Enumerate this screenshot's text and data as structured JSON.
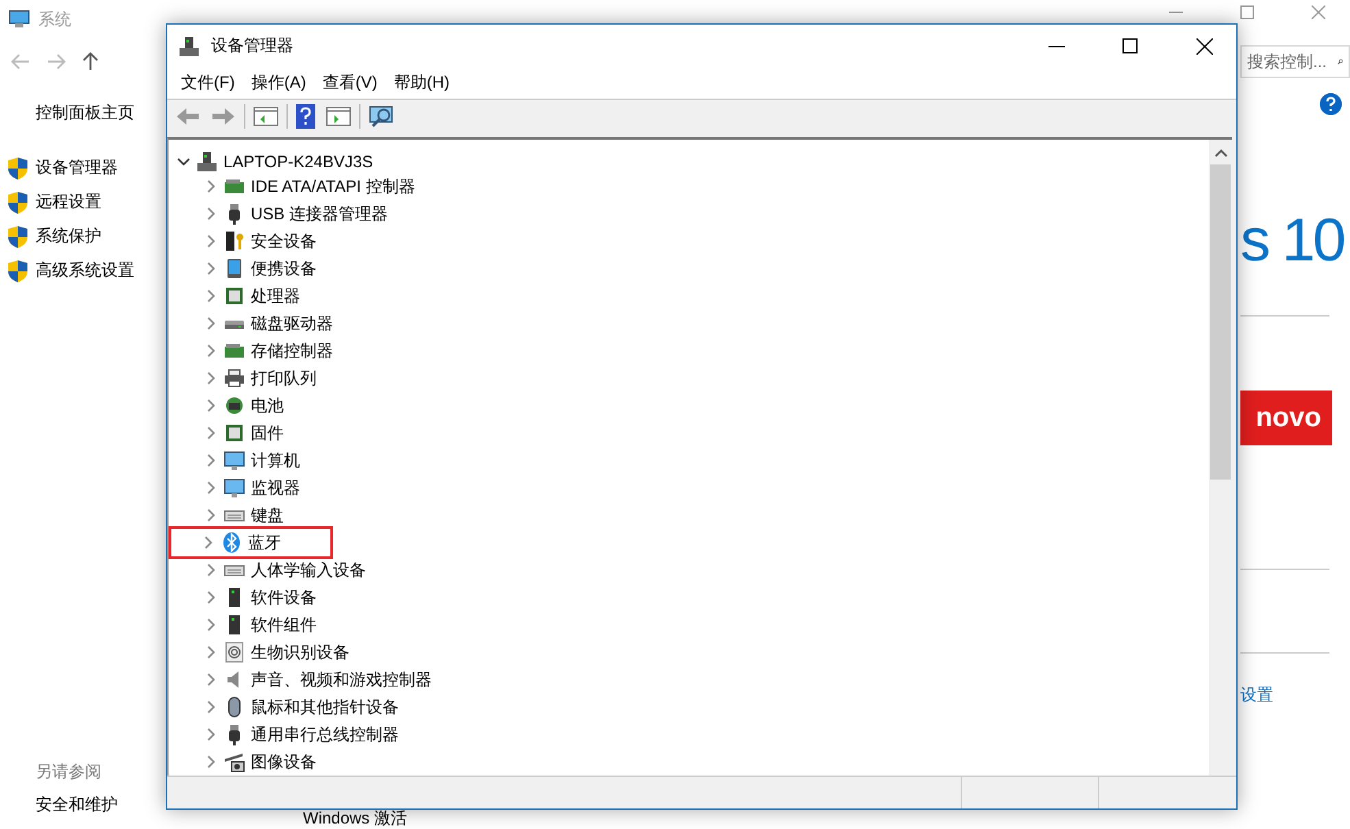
{
  "system_window": {
    "title": "系统",
    "search": {
      "placeholder": "搜索控制..."
    },
    "sidebar": {
      "home": "控制面板主页",
      "links": [
        "设备管理器",
        "远程设置",
        "系统保护",
        "高级系统设置"
      ],
      "see_also_title": "另请参阅",
      "see_also": [
        "安全和维护"
      ]
    },
    "content": {
      "edition_text": "s 10",
      "logo_text": "novo",
      "link": "设置",
      "activation_text": "Windows 激活"
    }
  },
  "device_manager": {
    "title": "设备管理器",
    "menu": [
      "文件(F)",
      "操作(A)",
      "查看(V)",
      "帮助(H)"
    ],
    "tree": {
      "label": "LAPTOP-K24BVJ3S",
      "expanded": true,
      "children": [
        {
          "label": "IDE ATA/ATAPI 控制器",
          "expanded": false,
          "highlighted": false
        },
        {
          "label": "USB 连接器管理器",
          "expanded": false,
          "highlighted": false
        },
        {
          "label": "安全设备",
          "expanded": false,
          "highlighted": false
        },
        {
          "label": "便携设备",
          "expanded": false,
          "highlighted": false
        },
        {
          "label": "处理器",
          "expanded": false,
          "highlighted": false
        },
        {
          "label": "磁盘驱动器",
          "expanded": false,
          "highlighted": false
        },
        {
          "label": "存储控制器",
          "expanded": false,
          "highlighted": false
        },
        {
          "label": "打印队列",
          "expanded": false,
          "highlighted": false
        },
        {
          "label": "电池",
          "expanded": false,
          "highlighted": false
        },
        {
          "label": "固件",
          "expanded": false,
          "highlighted": false
        },
        {
          "label": "计算机",
          "expanded": false,
          "highlighted": false
        },
        {
          "label": "监视器",
          "expanded": false,
          "highlighted": false
        },
        {
          "label": "键盘",
          "expanded": false,
          "highlighted": false
        },
        {
          "label": "蓝牙",
          "expanded": false,
          "highlighted": true
        },
        {
          "label": "人体学输入设备",
          "expanded": false,
          "highlighted": false
        },
        {
          "label": "软件设备",
          "expanded": false,
          "highlighted": false
        },
        {
          "label": "软件组件",
          "expanded": false,
          "highlighted": false
        },
        {
          "label": "生物识别设备",
          "expanded": false,
          "highlighted": false
        },
        {
          "label": "声音、视频和游戏控制器",
          "expanded": false,
          "highlighted": false
        },
        {
          "label": "鼠标和其他指针设备",
          "expanded": false,
          "highlighted": false
        },
        {
          "label": "通用串行总线控制器",
          "expanded": false,
          "highlighted": false
        },
        {
          "label": "图像设备",
          "expanded": false,
          "highlighted": false
        }
      ]
    }
  }
}
